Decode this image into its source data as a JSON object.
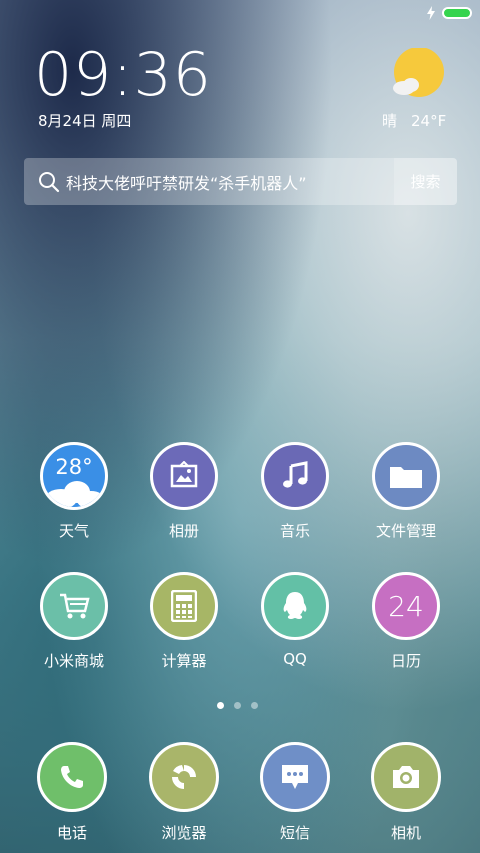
{
  "status": {
    "battery_color": "#35d44e"
  },
  "clock": {
    "time": "09:36",
    "date": "8月24日 周四"
  },
  "weather": {
    "condition": "晴",
    "temp": "24°F",
    "icon": "sun-cloud-icon"
  },
  "search": {
    "text": "科技大佬呼吁禁研发“杀手机器人”",
    "button": "搜索"
  },
  "apps": [
    {
      "label": "天气",
      "icon": "weather-icon",
      "color": "#3a8fe6",
      "badge": "28°"
    },
    {
      "label": "相册",
      "icon": "gallery-icon",
      "color": "#6c6ab8"
    },
    {
      "label": "音乐",
      "icon": "music-icon",
      "color": "#6a69b5"
    },
    {
      "label": "文件管理",
      "icon": "folder-icon",
      "color": "#6d8ac2"
    },
    {
      "label": "小米商城",
      "icon": "cart-icon",
      "color": "#6bbfa8"
    },
    {
      "label": "计算器",
      "icon": "calculator-icon",
      "color": "#a7b666"
    },
    {
      "label": "QQ",
      "icon": "qq-icon",
      "color": "#63c0a6"
    },
    {
      "label": "日历",
      "icon": "calendar-icon",
      "color": "#c66fc2",
      "badge": "24"
    }
  ],
  "dock": [
    {
      "label": "电话",
      "icon": "phone-icon",
      "color": "#6fbf6a"
    },
    {
      "label": "浏览器",
      "icon": "browser-icon",
      "color": "#a9b56a"
    },
    {
      "label": "短信",
      "icon": "message-icon",
      "color": "#6f8fc7"
    },
    {
      "label": "相机",
      "icon": "camera-icon",
      "color": "#a1b36a"
    }
  ],
  "pager": {
    "pages": 3,
    "current": 1
  }
}
